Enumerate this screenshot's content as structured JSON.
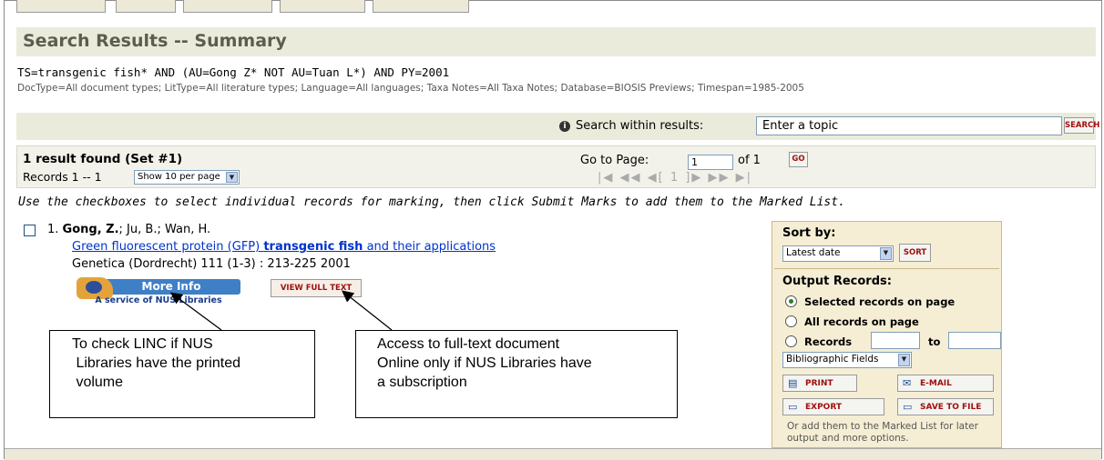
{
  "page": {
    "title": "Search Results -- Summary"
  },
  "query": {
    "text": "TS=transgenic fish* AND (AU=Gong Z* NOT AU=Tuan L*) AND PY=2001",
    "details": "DocType=All document types; LitType=All literature types; Language=All languages; Taxa Notes=All Taxa Notes; Database=BIOSIS Previews; Timespan=1985-2005"
  },
  "search_within": {
    "label": "Search within results:",
    "placeholder": "Enter a topic",
    "value": "Enter a topic",
    "button": "SEARCH"
  },
  "results": {
    "count_text": "1 result found (Set #1)",
    "records_label": "Records 1 -- 1",
    "per_page": "Show 10 per page",
    "goto_label": "Go to Page:",
    "goto_value": "1",
    "of_label": "of 1",
    "go_button": "GO",
    "pager": "|◀ ◀◀ ◀[ 1 ]▶ ▶▶ ▶|"
  },
  "instructions": "Use the checkboxes to select individual records for marking, then click Submit Marks to add them to the Marked List.",
  "record": {
    "number": "1.",
    "author_bold": "Gong, Z.",
    "authors_rest": "; Ju, B.; Wan, H.",
    "title_before": "Green fluorescent protein (GFP) ",
    "title_bold": "transgenic fish",
    "title_after": " and their applications",
    "journal": "Genetica (Dordrecht) 111 (1-3) : 213-225 2001",
    "more_info": "More Info",
    "more_info_sub": "A service of NUS Libraries",
    "full_text": "VIEW FULL TEXT"
  },
  "sidebar": {
    "sort_label": "Sort by:",
    "sort_value": "Latest date",
    "sort_button": "SORT",
    "output_label": "Output Records:",
    "options": [
      "Selected records on page",
      "All records on page",
      "Records"
    ],
    "to_label": "to",
    "fields_value": "Bibliographic Fields",
    "print": "PRINT",
    "email": "E-MAIL",
    "export": "EXPORT",
    "save": "SAVE TO FILE",
    "note": "Or add them to the Marked List for later output and more options."
  },
  "callouts": {
    "linc": "To check LINC if NUS Libraries have the printed volume",
    "linc_lines": [
      "To check LINC if NUS",
      " Libraries have the printed",
      " volume"
    ],
    "fulltext_lines": [
      "Access to full-text document",
      "Online only if NUS Libraries have",
      "a subscription"
    ]
  }
}
